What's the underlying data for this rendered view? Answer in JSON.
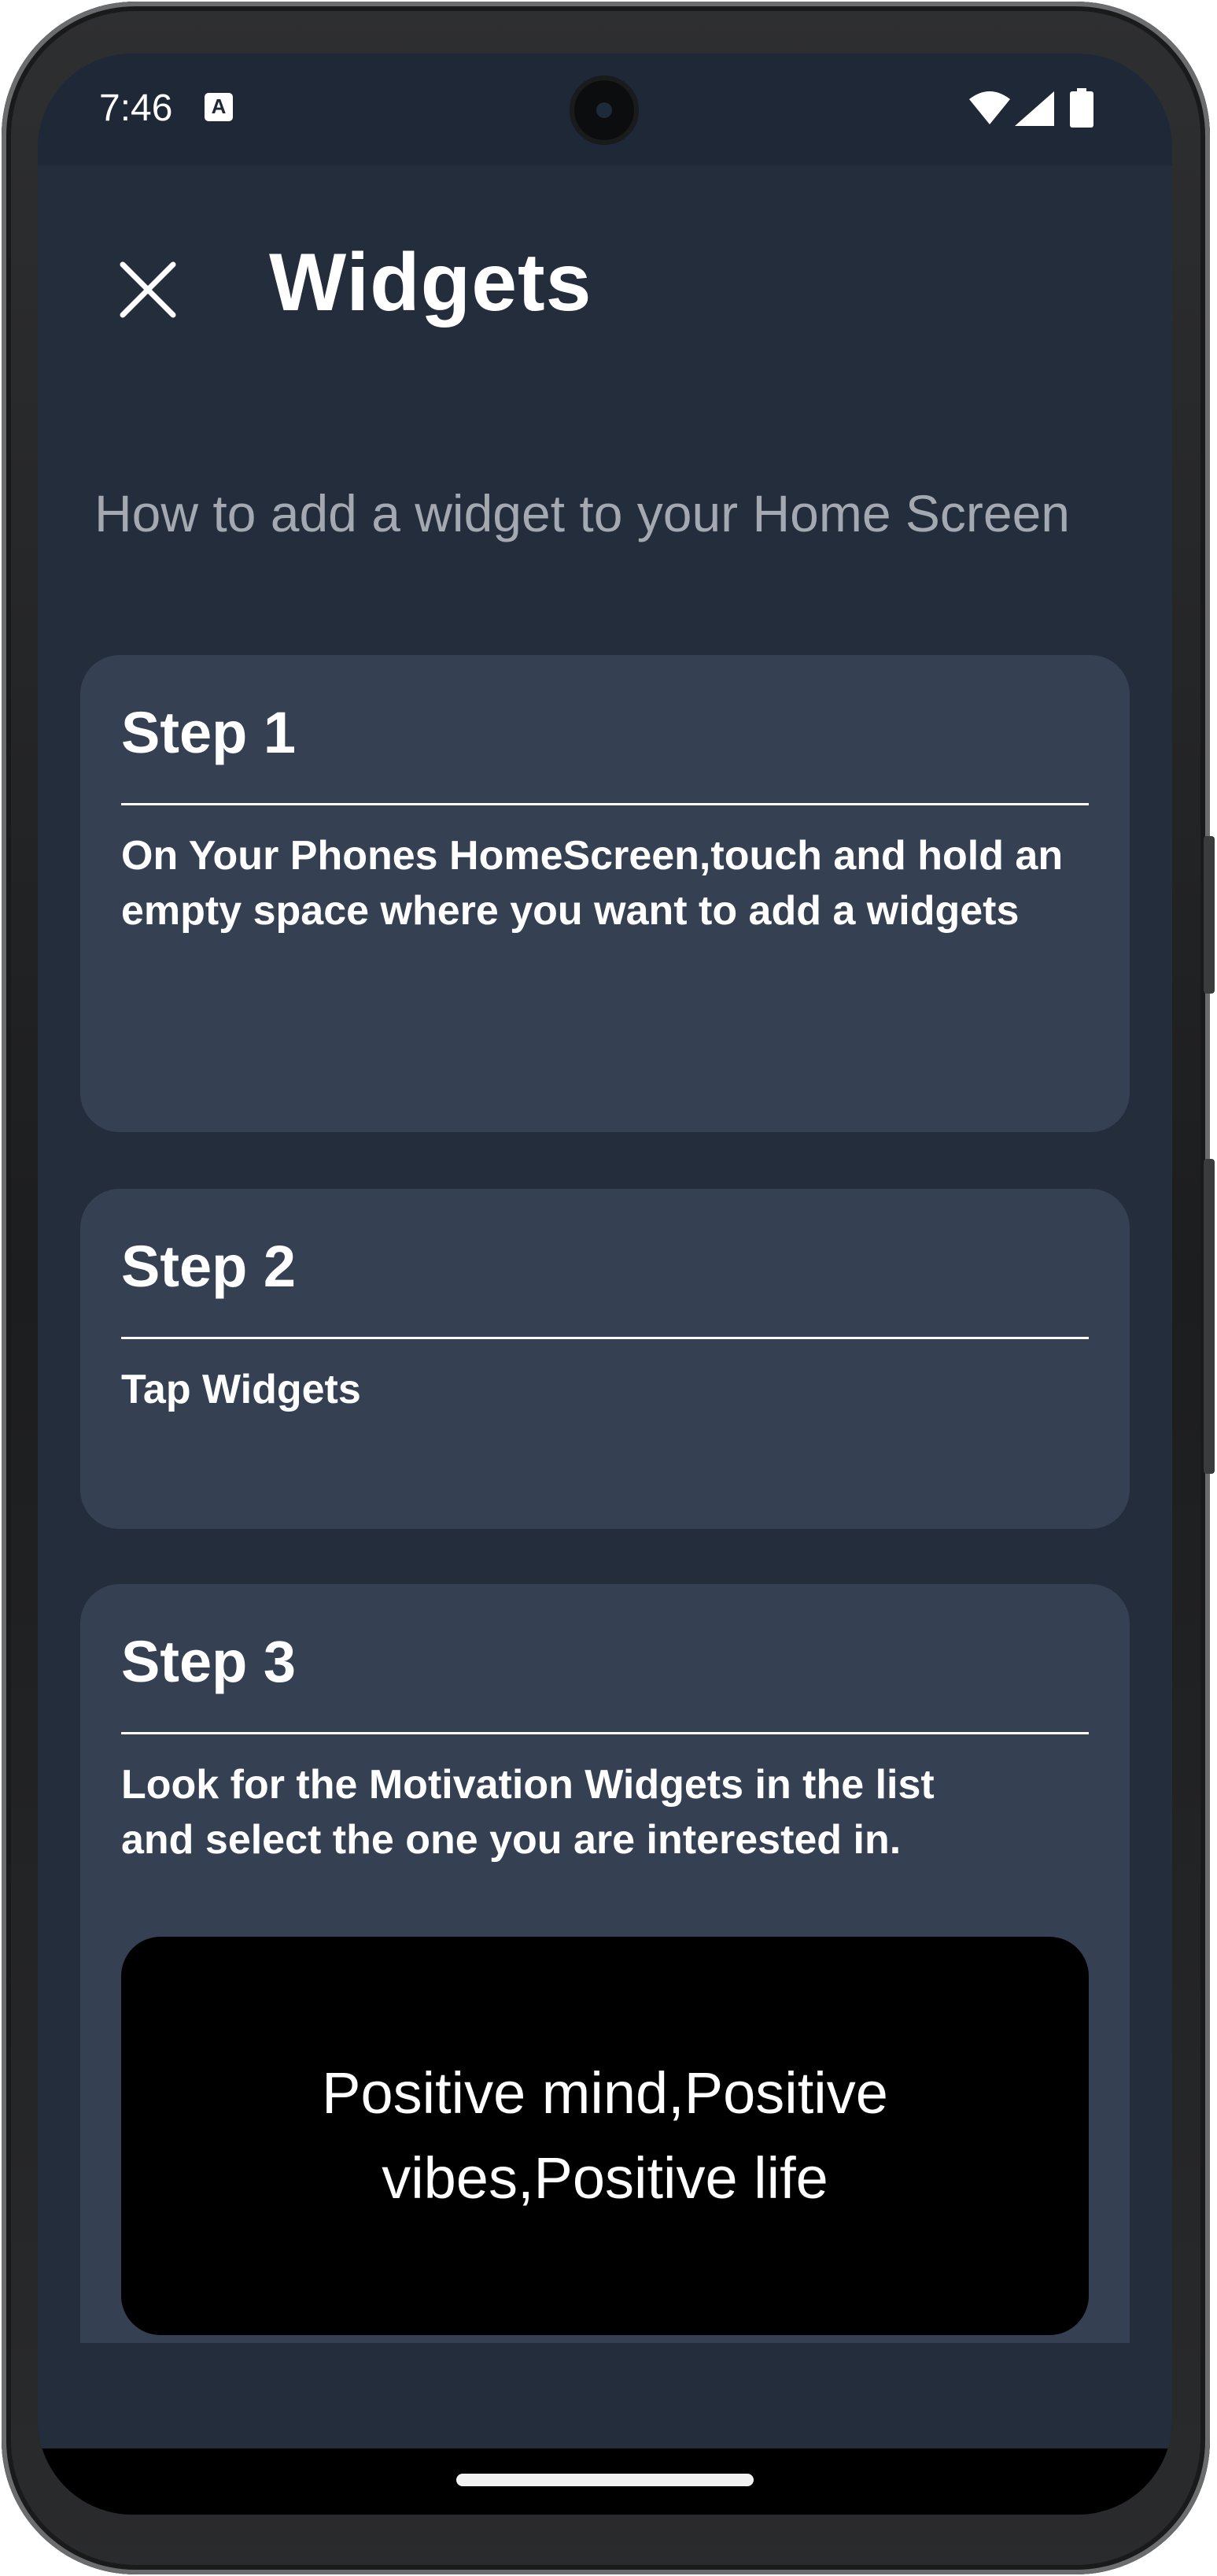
{
  "status_bar": {
    "time": "7:46",
    "keyboard_icon_glyph": "A"
  },
  "header": {
    "title": "Widgets"
  },
  "subtitle": "How to add a widget to your Home Screen",
  "steps": [
    {
      "title": "Step 1",
      "text": "On Your Phones HomeScreen,touch and hold an empty space where you want to add a widgets"
    },
    {
      "title": "Step 2",
      "text": "Tap Widgets"
    },
    {
      "title": "Step 3",
      "text": "Look for the Motivation Widgets in the list and select the one you are interested in."
    }
  ],
  "widget_preview": {
    "quote": "Positive mind,Positive vibes,Positive life"
  },
  "colors": {
    "background": "#232d3c",
    "card": "#354153",
    "subtitle": "#a4a9b1",
    "text": "#ffffff",
    "widget_background": "#000000"
  }
}
